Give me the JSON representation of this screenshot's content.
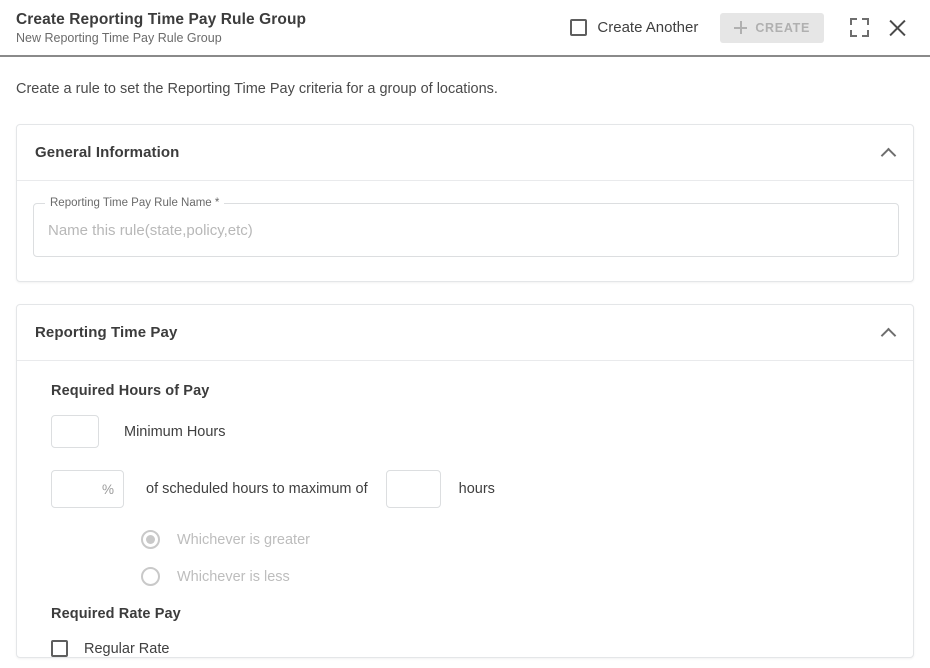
{
  "header": {
    "title": "Create Reporting Time Pay Rule Group",
    "subtitle": "New Reporting Time Pay Rule Group",
    "create_another_label": "Create Another",
    "create_button_label": "CREATE",
    "create_button_disabled": true,
    "icons": {
      "plus": "plus-icon",
      "fullscreen": "fullscreen-icon",
      "close": "close-icon",
      "checkbox": "checkbox-unchecked-icon"
    },
    "colors": {
      "title_text": "#3c3c3c",
      "subtitle_text": "#6b6b6b",
      "create_button_bg": "#e6e6e6",
      "create_button_text": "#b0b0b0",
      "border": "#8a8a8a"
    }
  },
  "main": {
    "intro": "Create a rule to set the Reporting Time Pay criteria for a group of locations.",
    "cards": [
      {
        "title": "General Information",
        "expanded": true,
        "chevron": "chevron-up-icon",
        "field": {
          "label": "Reporting Time Pay Rule Name *",
          "placeholder": "Name this rule(state,policy,etc)",
          "value": ""
        }
      },
      {
        "title": "Reporting Time Pay",
        "expanded": true,
        "chevron": "chevron-up-icon",
        "required_hours_heading": "Required Hours of Pay",
        "minimum_hours": {
          "value": "",
          "label": "Minimum Hours"
        },
        "percent_rule": {
          "percent_value": "",
          "percent_suffix": "%",
          "middle_label": "of scheduled hours to maximum of",
          "max_hours_value": "",
          "trailing_label": "hours"
        },
        "radios": [
          {
            "label": "Whichever is greater",
            "selected": true,
            "disabled": true
          },
          {
            "label": "Whichever is less",
            "selected": false,
            "disabled": true
          }
        ],
        "required_rate_heading": "Required Rate Pay",
        "regular_rate": {
          "label": "Regular Rate",
          "checked": false
        }
      }
    ]
  },
  "colors": {
    "card_border": "#e4e6e8",
    "input_border": "#dcdee0",
    "disabled_text": "#bdbdbd",
    "body_text": "#3f3f3f"
  }
}
